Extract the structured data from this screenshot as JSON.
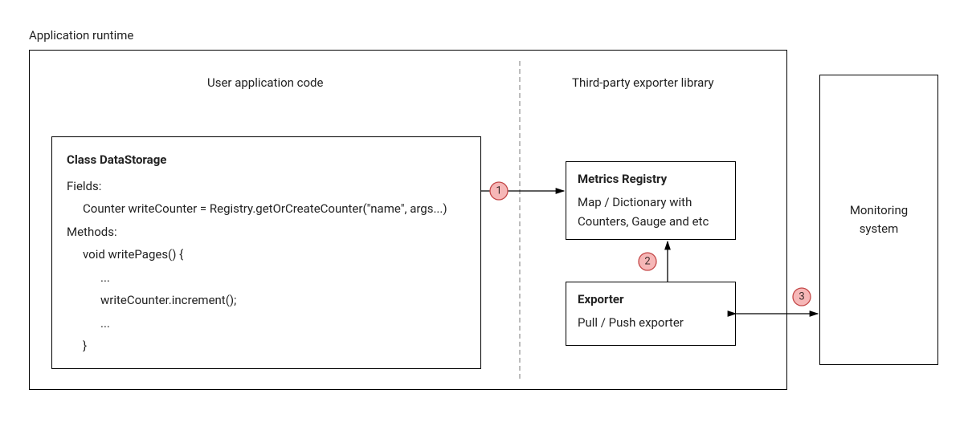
{
  "runtime": {
    "label": "Application runtime"
  },
  "sections": {
    "left_title": "User application code",
    "right_title": "Third-party exporter library"
  },
  "storage": {
    "class_name": "Class DataStorage",
    "fields_label": "Fields:",
    "field_line": "Counter writeCounter = Registry.getOrCreateCounter(\"name\", args...)",
    "methods_label": "Methods:",
    "method_sig": "void writePages() {",
    "dots1": "...",
    "method_body": "writeCounter.increment();",
    "dots2": "...",
    "brace_close": "}"
  },
  "registry": {
    "title": "Metrics Registry",
    "desc": "Map / Dictionary with Counters, Gauge and etc"
  },
  "exporter": {
    "title": "Exporter",
    "desc": "Pull / Push exporter"
  },
  "monitor": {
    "line1": "Monitoring",
    "line2": "system"
  },
  "steps": {
    "s1": "1",
    "s2": "2",
    "s3": "3"
  }
}
